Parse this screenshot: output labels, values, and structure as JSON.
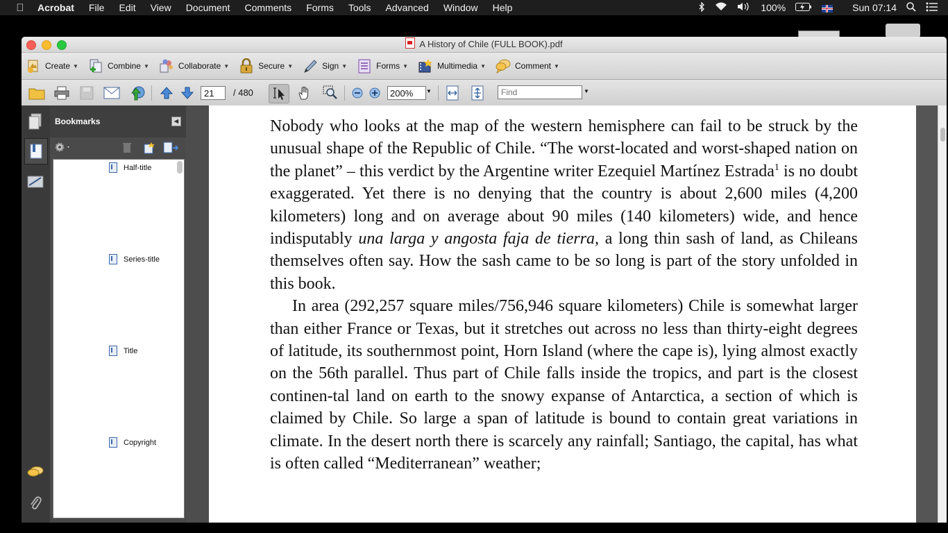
{
  "menubar": {
    "app": "Acrobat",
    "items": [
      "File",
      "Edit",
      "View",
      "Document",
      "Comments",
      "Forms",
      "Tools",
      "Advanced",
      "Window",
      "Help"
    ],
    "battery": "100%",
    "clock": "Sun 07:14"
  },
  "window": {
    "title": "A History of Chile (FULL BOOK).pdf"
  },
  "tasks": [
    {
      "label": "Create",
      "icon": "create-icon"
    },
    {
      "label": "Combine",
      "icon": "combine-icon"
    },
    {
      "label": "Collaborate",
      "icon": "collaborate-icon"
    },
    {
      "label": "Secure",
      "icon": "lock-icon"
    },
    {
      "label": "Sign",
      "icon": "pen-icon"
    },
    {
      "label": "Forms",
      "icon": "form-icon"
    },
    {
      "label": "Multimedia",
      "icon": "multimedia-icon"
    },
    {
      "label": "Comment",
      "icon": "speech-bubble-icon"
    }
  ],
  "toolbar": {
    "page_current": "21",
    "page_total": "/ 480",
    "zoom": "200%",
    "find_placeholder": "Find"
  },
  "bookmarks": {
    "title": "Bookmarks",
    "items": [
      "Half-title",
      "Series-title",
      "Title",
      "Copyright"
    ]
  },
  "document": {
    "paragraph1_a": "Nobody who looks at the map of the western hemisphere can fail to be struck by the unusual shape of the Republic of Chile. “The worst-located and worst-shaped nation on the planet” – this verdict by the Argentine writer Ezequiel Martínez Estrada",
    "footnote": "1",
    "paragraph1_b": " is no doubt exaggerated. Yet there is no denying that the country is about 2,600 miles (4,200 kilometers) long and on average about 90 miles (140 kilometers) wide, and hence indisputably ",
    "italic_phrase": "una larga y angosta faja de tierra,",
    "paragraph1_c": " a long thin sash of land, as Chileans themselves often say. How the sash came to be so long is part of the story unfolded in this book.",
    "paragraph2": "In area (292,257 square miles/756,946 square kilometers) Chile is somewhat larger than either France or Texas, but it stretches out across no less than thirty-eight degrees of latitude, its southernmost point, Horn Island (where the cape is), lying almost exactly on the 56th parallel. Thus part of Chile falls inside the tropics, and part is the closest continen-tal land on earth to the snowy expanse of Antarctica, a section of which is claimed by Chile. So large a span of latitude is bound to contain great variations in climate. In the desert north there is scarcely any rainfall; Santiago, the capital, has what is often called “Mediterranean” weather;"
  }
}
